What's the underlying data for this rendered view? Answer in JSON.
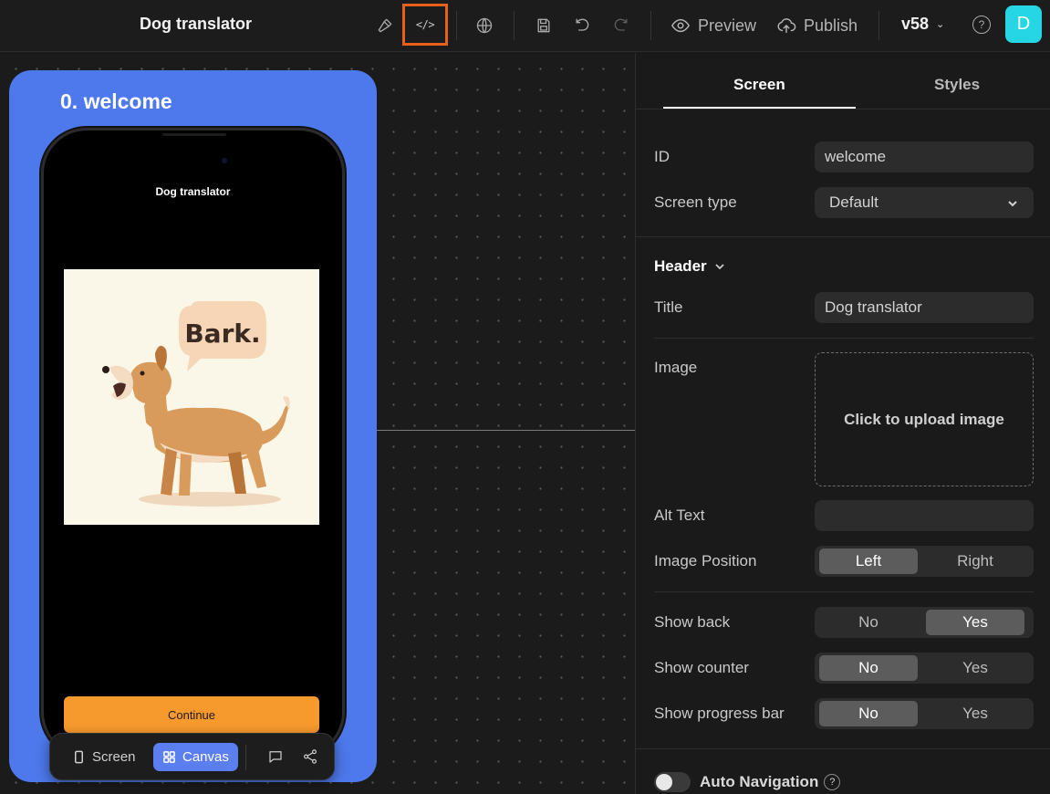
{
  "app": {
    "title": "Dog translator",
    "version": "v58",
    "avatar_initial": "D",
    "accent": "#26d6e4"
  },
  "toolbar": {
    "code_label": "</>",
    "preview_label": "Preview",
    "publish_label": "Publish",
    "help_label": "?",
    "icons": [
      "hammer-icon",
      "code-icon",
      "globe-icon",
      "save-icon",
      "undo-icon",
      "redo-icon",
      "eye-icon",
      "cloud-upload-icon",
      "help-icon"
    ]
  },
  "canvas": {
    "frame_title": "0. welcome",
    "frame_color": "#4d79ed",
    "phone": {
      "title": "Dog translator",
      "image_speech": "Bark.",
      "continue_label": "Continue",
      "button_color": "#f79a2e"
    },
    "bottom_toolbar": {
      "screen_label": "Screen",
      "canvas_label": "Canvas",
      "active": "Canvas"
    }
  },
  "panel": {
    "tabs": [
      "Screen",
      "Styles"
    ],
    "active_tab": "Screen",
    "id": {
      "label": "ID",
      "value": "welcome"
    },
    "screen_type": {
      "label": "Screen type",
      "value": "Default"
    },
    "header": {
      "title": "Header",
      "title_field": {
        "label": "Title",
        "value": "Dog translator"
      },
      "image": {
        "label": "Image",
        "upload_text": "Click to upload image"
      },
      "alt_text": {
        "label": "Alt Text",
        "value": ""
      },
      "image_position": {
        "label": "Image Position",
        "options": [
          "Left",
          "Right"
        ],
        "selected": "Left"
      }
    },
    "show_back": {
      "label": "Show back",
      "options": [
        "No",
        "Yes"
      ],
      "selected": "Yes"
    },
    "show_counter": {
      "label": "Show counter",
      "options": [
        "No",
        "Yes"
      ],
      "selected": "No"
    },
    "show_progress_bar": {
      "label": "Show progress bar",
      "options": [
        "No",
        "Yes"
      ],
      "selected": "No"
    },
    "auto_navigation": {
      "label": "Auto Navigation",
      "enabled": false,
      "help": "?"
    }
  }
}
